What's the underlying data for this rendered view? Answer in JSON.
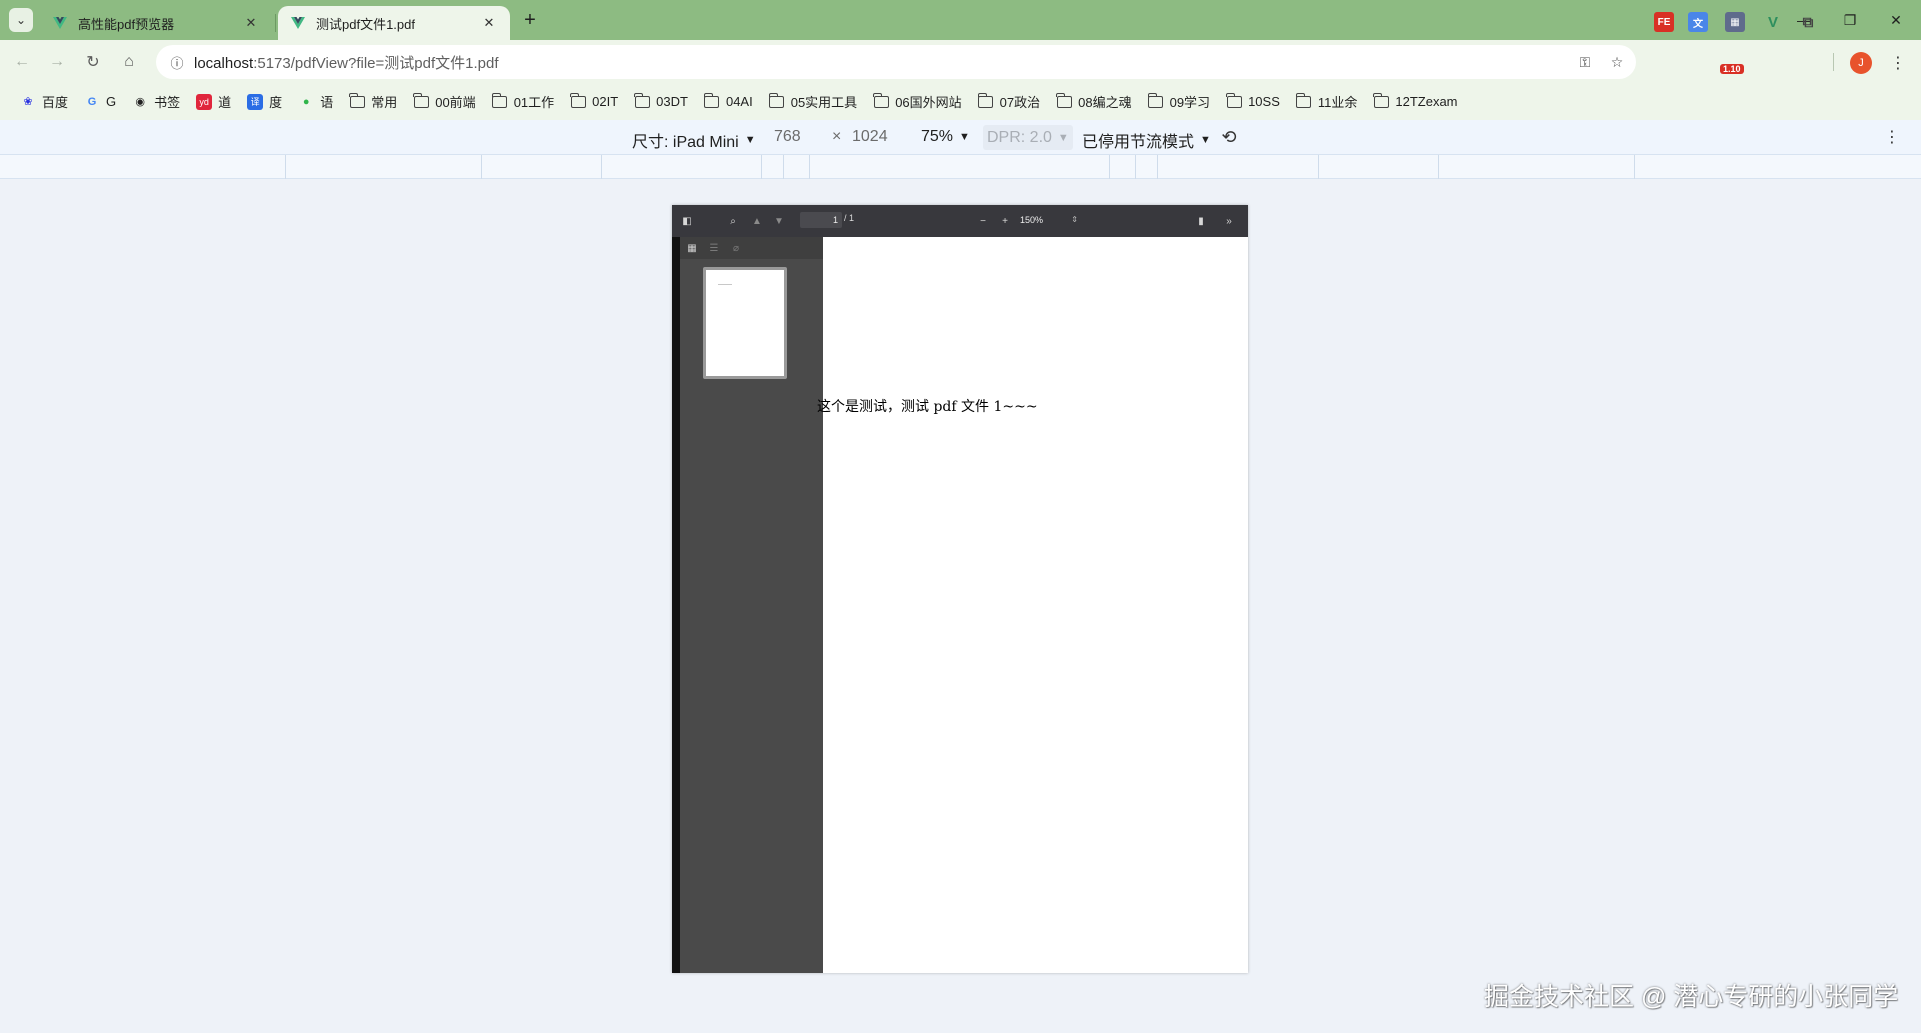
{
  "tabs": [
    {
      "title": "高性能pdf预览器",
      "active": false
    },
    {
      "title": "测试pdf文件1.pdf",
      "active": true
    }
  ],
  "omnibox": {
    "host": "localhost",
    "rest": ":5173/pdfView?file=测试pdf文件1.pdf"
  },
  "extensions": {
    "badge": "1.10",
    "avatar_letter": "J"
  },
  "bookmarks": [
    {
      "label": "百度",
      "icon": "baidu-icon"
    },
    {
      "label": "G",
      "icon": "google-icon"
    },
    {
      "label": "书签",
      "icon": "globe-icon"
    },
    {
      "label": "道",
      "icon": "youdao-icon"
    },
    {
      "label": "度",
      "icon": "translate-icon"
    },
    {
      "label": "语",
      "icon": "leaf-icon"
    },
    {
      "label": "常用",
      "icon": "folder-icon"
    },
    {
      "label": "00前端",
      "icon": "folder-icon"
    },
    {
      "label": "01工作",
      "icon": "folder-icon"
    },
    {
      "label": "02IT",
      "icon": "folder-icon"
    },
    {
      "label": "03DT",
      "icon": "folder-icon"
    },
    {
      "label": "04AI",
      "icon": "folder-icon"
    },
    {
      "label": "05实用工具",
      "icon": "folder-icon"
    },
    {
      "label": "06国外网站",
      "icon": "folder-icon"
    },
    {
      "label": "07政治",
      "icon": "folder-icon"
    },
    {
      "label": "08编之魂",
      "icon": "folder-icon"
    },
    {
      "label": "09学习",
      "icon": "folder-icon"
    },
    {
      "label": "10SS",
      "icon": "folder-icon"
    },
    {
      "label": "11业余",
      "icon": "folder-icon"
    },
    {
      "label": "12TZexam",
      "icon": "folder-icon"
    }
  ],
  "device_toolbar": {
    "dimensions": "尺寸: iPad Mini",
    "width": "768",
    "times": "×",
    "height": "1024",
    "zoom": "75%",
    "dpr": "DPR: 2.0",
    "throttling": "已停用节流模式"
  },
  "pdf_viewer": {
    "page_number": "1",
    "page_total": "/ 1",
    "zoom": "150%",
    "content_text": "这个是测试，测试 pdf 文件 1~~~"
  },
  "watermark": "掘金技术社区 @ 潜心专研的小张同学",
  "colors": {
    "tab_strip": "#8dbb82",
    "toolbar": "#eef5ea",
    "device_toolbar": "#eff5fd",
    "page_bg": "#eef2f8",
    "pdf_toolbar": "#38383d",
    "pdf_sidebar": "#4a4a4a",
    "avatar": "#e8532c"
  }
}
